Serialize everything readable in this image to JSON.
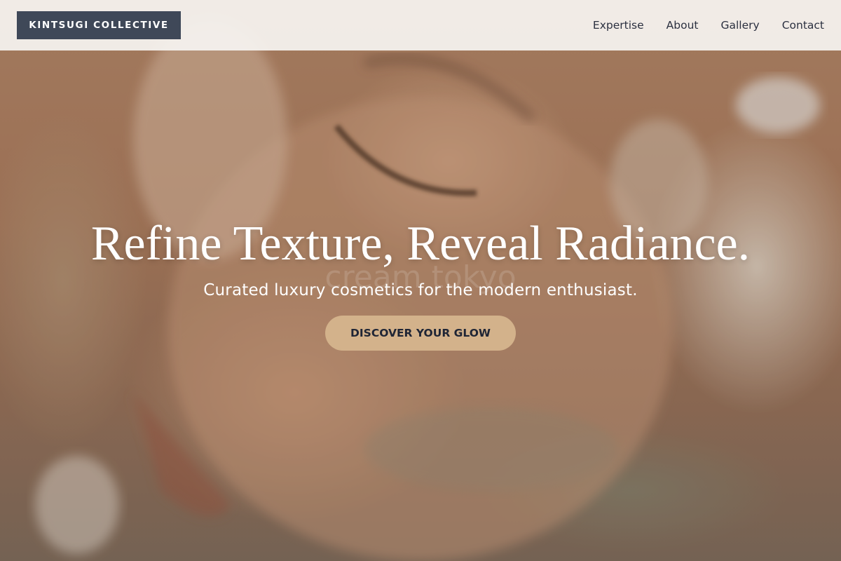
{
  "header": {
    "logo_text": "KINTSUGI COLLECTIVE",
    "nav": [
      {
        "label": "Expertise"
      },
      {
        "label": "About"
      },
      {
        "label": "Gallery"
      },
      {
        "label": "Contact"
      }
    ]
  },
  "hero": {
    "title": "Refine Texture, Reveal Radiance.",
    "subtitle": "Curated luxury cosmetics for the modern enthusiast.",
    "cta_label": "DISCOVER YOUR GLOW",
    "watermark_text": "cream tokyo"
  },
  "colors": {
    "logo_bg": "#3f4858",
    "cta_bg": "#d3b28b",
    "nav_text": "#2b3040",
    "header_bg": "#f6f4f1"
  }
}
